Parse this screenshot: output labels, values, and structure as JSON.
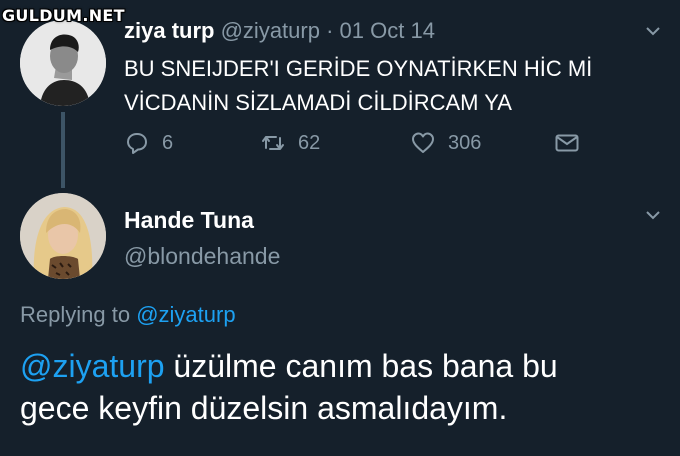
{
  "watermark": "GULDUM.NET",
  "tweet": {
    "name": "ziya turp",
    "handle": "@ziyaturp",
    "separator": "·",
    "date": "01 Oct 14",
    "text_line1": "BU SNEIJDER'I GERİDE OYNATİRKEN HİC Mİ",
    "text_line2": "VİCDANİN SİZLAMADİ CİLDİRCAM YA",
    "reply_count": "6",
    "retweet_count": "62",
    "like_count": "306"
  },
  "reply": {
    "name": "Hande Tuna",
    "handle": "@blondehande",
    "replying_prefix": "Replying to",
    "replying_to": "@ziyaturp",
    "mention": "@ziyaturp",
    "text_line1": " üzülme canım bas bana bu",
    "text_line2": "gece keyfin düzelsin asmalıdayım."
  },
  "colors": {
    "background": "#15202b",
    "muted": "#8899a6",
    "link": "#1da1f2",
    "thread_line": "#3d5466"
  },
  "icons": [
    "chevron-down-icon",
    "reply-icon",
    "retweet-icon",
    "heart-icon",
    "envelope-icon"
  ]
}
